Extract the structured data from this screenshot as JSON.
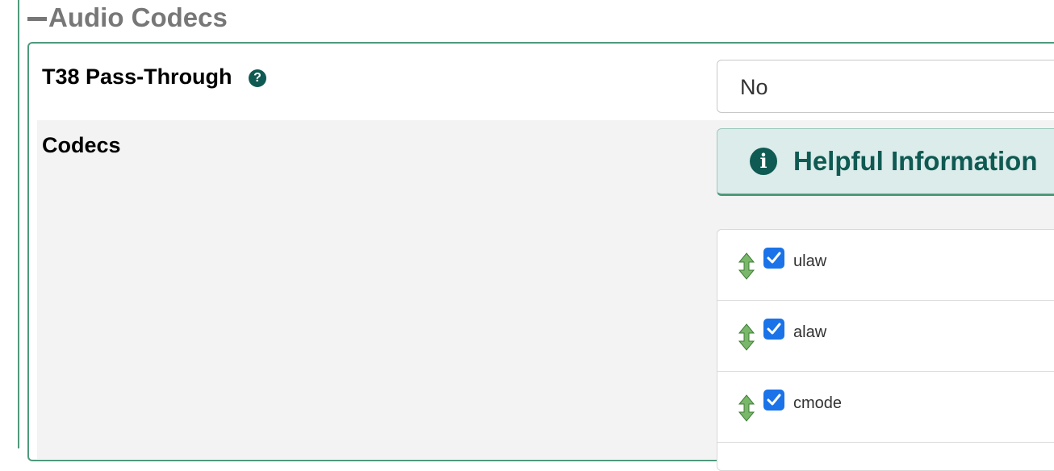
{
  "section": {
    "title": "Audio Codecs"
  },
  "t38": {
    "label": "T38 Pass-Through",
    "help_icon": "?",
    "value": "No"
  },
  "codecs": {
    "label": "Codecs",
    "helpful_title": "Helpful Information",
    "info_icon": "i",
    "items": [
      {
        "name": "ulaw",
        "checked": true
      },
      {
        "name": "alaw",
        "checked": true
      },
      {
        "name": "cmode",
        "checked": true
      }
    ]
  },
  "colors": {
    "accent": "#0f5a52",
    "border": "#4f9a7b",
    "checkbox": "#1a73e8"
  }
}
